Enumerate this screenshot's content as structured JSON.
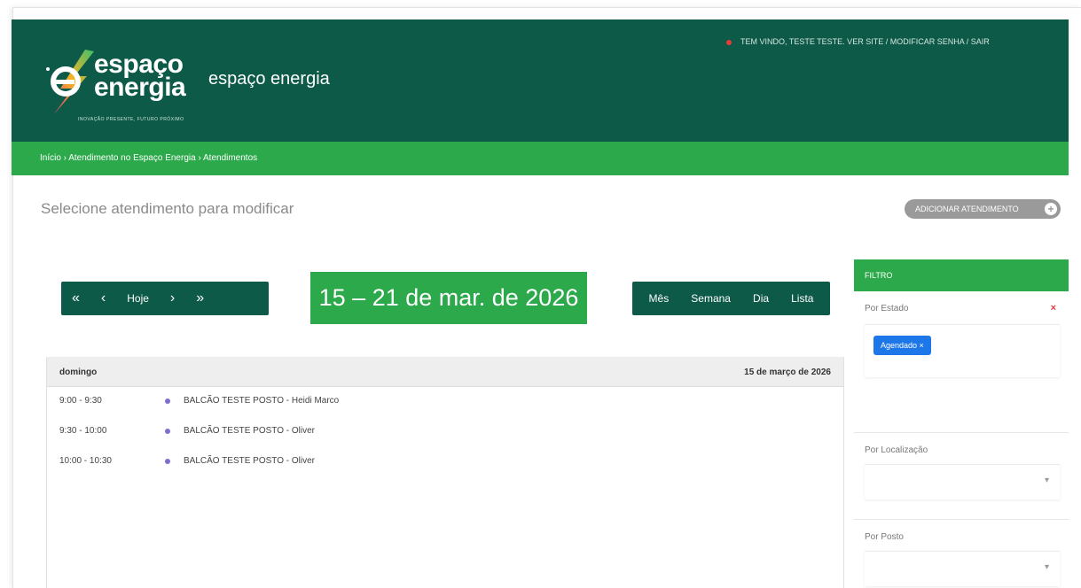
{
  "header": {
    "logo_line1": "espaço",
    "logo_line2": "energia",
    "logo_tagline": "INOVAÇÃO PRESENTE, FUTURO PRÓXIMO",
    "site_name": "espaço energia",
    "user_info": "TEM VINDO, TESTE TESTE. VER SITE / MODIFICAR SENHA / SAIR"
  },
  "breadcrumb": "Início › Atendimento no Espaço Energia › Atendimentos",
  "page": {
    "title": "Selecione atendimento para modificar",
    "add_button": "ADICIONAR ATENDIMENTO"
  },
  "calendar": {
    "nav": {
      "first": "«",
      "prev": "‹",
      "today": "Hoje",
      "next": "›",
      "last": "»"
    },
    "range_title": "15 – 21 de mar. de 2026",
    "views": [
      "Mês",
      "Semana",
      "Dia",
      "Lista"
    ],
    "day": {
      "name": "domingo",
      "date": "15 de março de 2026"
    },
    "events": [
      {
        "time": "9:00 - 9:30",
        "title": "BALCÃO TESTE POSTO - Heidi Marco"
      },
      {
        "time": "9:30 - 10:00",
        "title": "BALCÃO TESTE POSTO - Oliver"
      },
      {
        "time": "10:00 - 10:30",
        "title": "BALCÃO TESTE POSTO - Oliver"
      }
    ]
  },
  "filters": {
    "title": "FILTRO",
    "by_status": {
      "label": "Por Estado",
      "clear": "×",
      "tag": "Agendado ×"
    },
    "by_location": {
      "label": "Por Localização",
      "value": ""
    },
    "by_post": {
      "label": "Por Posto",
      "value": ""
    }
  },
  "colors": {
    "header": "#0d5a48",
    "accent_green": "#2ca94a",
    "tag_blue": "#1e77e8",
    "event_dot": "#7b6ecf"
  }
}
